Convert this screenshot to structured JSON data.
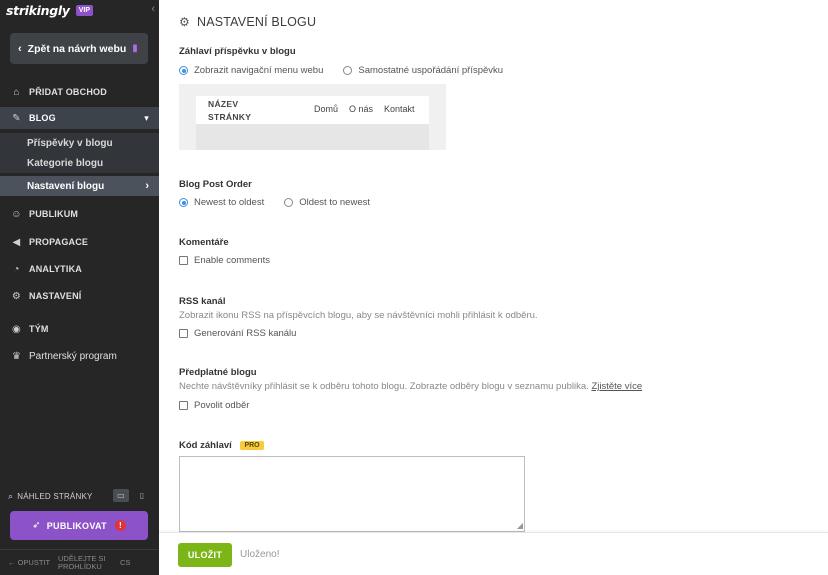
{
  "sidebar": {
    "logo": "strikingly",
    "vip_badge": "VIP",
    "back_button": "Zpět na návrh webu",
    "nav": {
      "store": "PŘIDAT OBCHOD",
      "blog": "BLOG",
      "audience": "PUBLIKUM",
      "promotion": "PROPAGACE",
      "analytics": "ANALYTIKA",
      "settings": "NASTAVENÍ",
      "team": "TÝM",
      "partner": "Partnerský program"
    },
    "blog_sub": {
      "posts": "Příspěvky v blogu",
      "categories": "Kategorie blogu",
      "settings": "Nastavení blogu"
    },
    "preview_label": "NÁHLED STRÁNKY",
    "publish_button": "PUBLIKOVAT",
    "footer": {
      "exit": "OPUSTIT",
      "feedback": "UDĚLEJTE SI PROHLÍDKU",
      "language": "CS"
    }
  },
  "main": {
    "title": "NASTAVENÍ BLOGU",
    "post_header": {
      "label": "Záhlaví příspěvku v blogu",
      "option_nav": "Zobrazit navigační menu webu",
      "option_standalone": "Samostatné uspořádání příspěvku",
      "preview": {
        "site_name_line1": "NÁZEV",
        "site_name_line2": "STRÁNKY",
        "links": [
          "Domů",
          "O nás",
          "Kontakt"
        ]
      }
    },
    "post_order": {
      "label": "Blog Post Order",
      "option_newest": "Newest to oldest",
      "option_oldest": "Oldest to newest"
    },
    "comments": {
      "label": "Komentáře",
      "checkbox": "Enable comments"
    },
    "rss": {
      "label": "RSS kanál",
      "description": "Zobrazit ikonu RSS na příspěvcích blogu, aby se návštěvníci mohli přihlásit k odběru.",
      "checkbox": "Generování RSS kanálu"
    },
    "subscription": {
      "label": "Předplatné blogu",
      "description": "Nechte návštěvníky přihlásit se k odběru tohoto blogu. Zobrazte odběry blogu v seznamu publika.",
      "link": "Zjistěte více",
      "checkbox": "Povolit odběr"
    },
    "header_code": {
      "label": "Kód záhlaví",
      "badge": "PRO",
      "value": ""
    }
  },
  "footer": {
    "save": "ULOŽIT",
    "status": "Uloženo!"
  },
  "colors": {
    "sidebar_bg": "#262626",
    "brand_purple": "#8c52c7",
    "save_green": "#7cb518",
    "radio_blue": "#3b8fe5",
    "pro_yellow": "#f6cb3d"
  }
}
